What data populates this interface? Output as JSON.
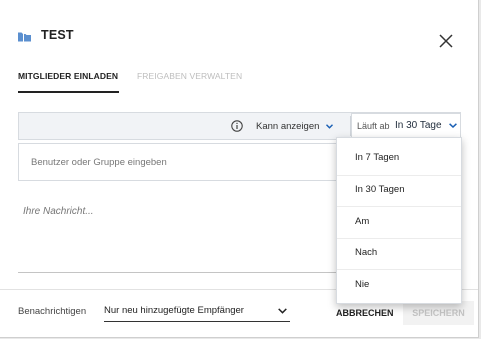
{
  "dialog": {
    "title": "TEST",
    "icon": "folder-share-icon",
    "close_icon": "close-icon"
  },
  "tabs": [
    {
      "label": "MITGLIEDER EINLADEN",
      "active": true
    },
    {
      "label": "FREIGABEN VERWALTEN",
      "active": false
    }
  ],
  "permissions": {
    "info_icon": "info-icon",
    "permission_label": "Kann anzeigen",
    "expiry_prefix": "Läuft ab",
    "expiry_value": "In 30 Tage"
  },
  "invite": {
    "user_placeholder": "Benutzer oder Gruppe eingeben",
    "message_placeholder": "Ihre Nachricht..."
  },
  "expiry_dropdown": {
    "options": [
      "In 7 Tagen",
      "In 30 Tagen",
      "Am",
      "Nach",
      "Nie"
    ]
  },
  "footer": {
    "notify_label": "Benachrichtigen",
    "notify_value": "Nur neu hinzugefügte Empfänger",
    "cancel_label": "ABBRECHEN",
    "save_label": "SPEICHERN"
  },
  "colors": {
    "accent": "#1a5fb4",
    "icon_blue": "#5b8fcf",
    "bar_bg": "#f1f3f6",
    "save_disabled": "#c4c4c4"
  }
}
